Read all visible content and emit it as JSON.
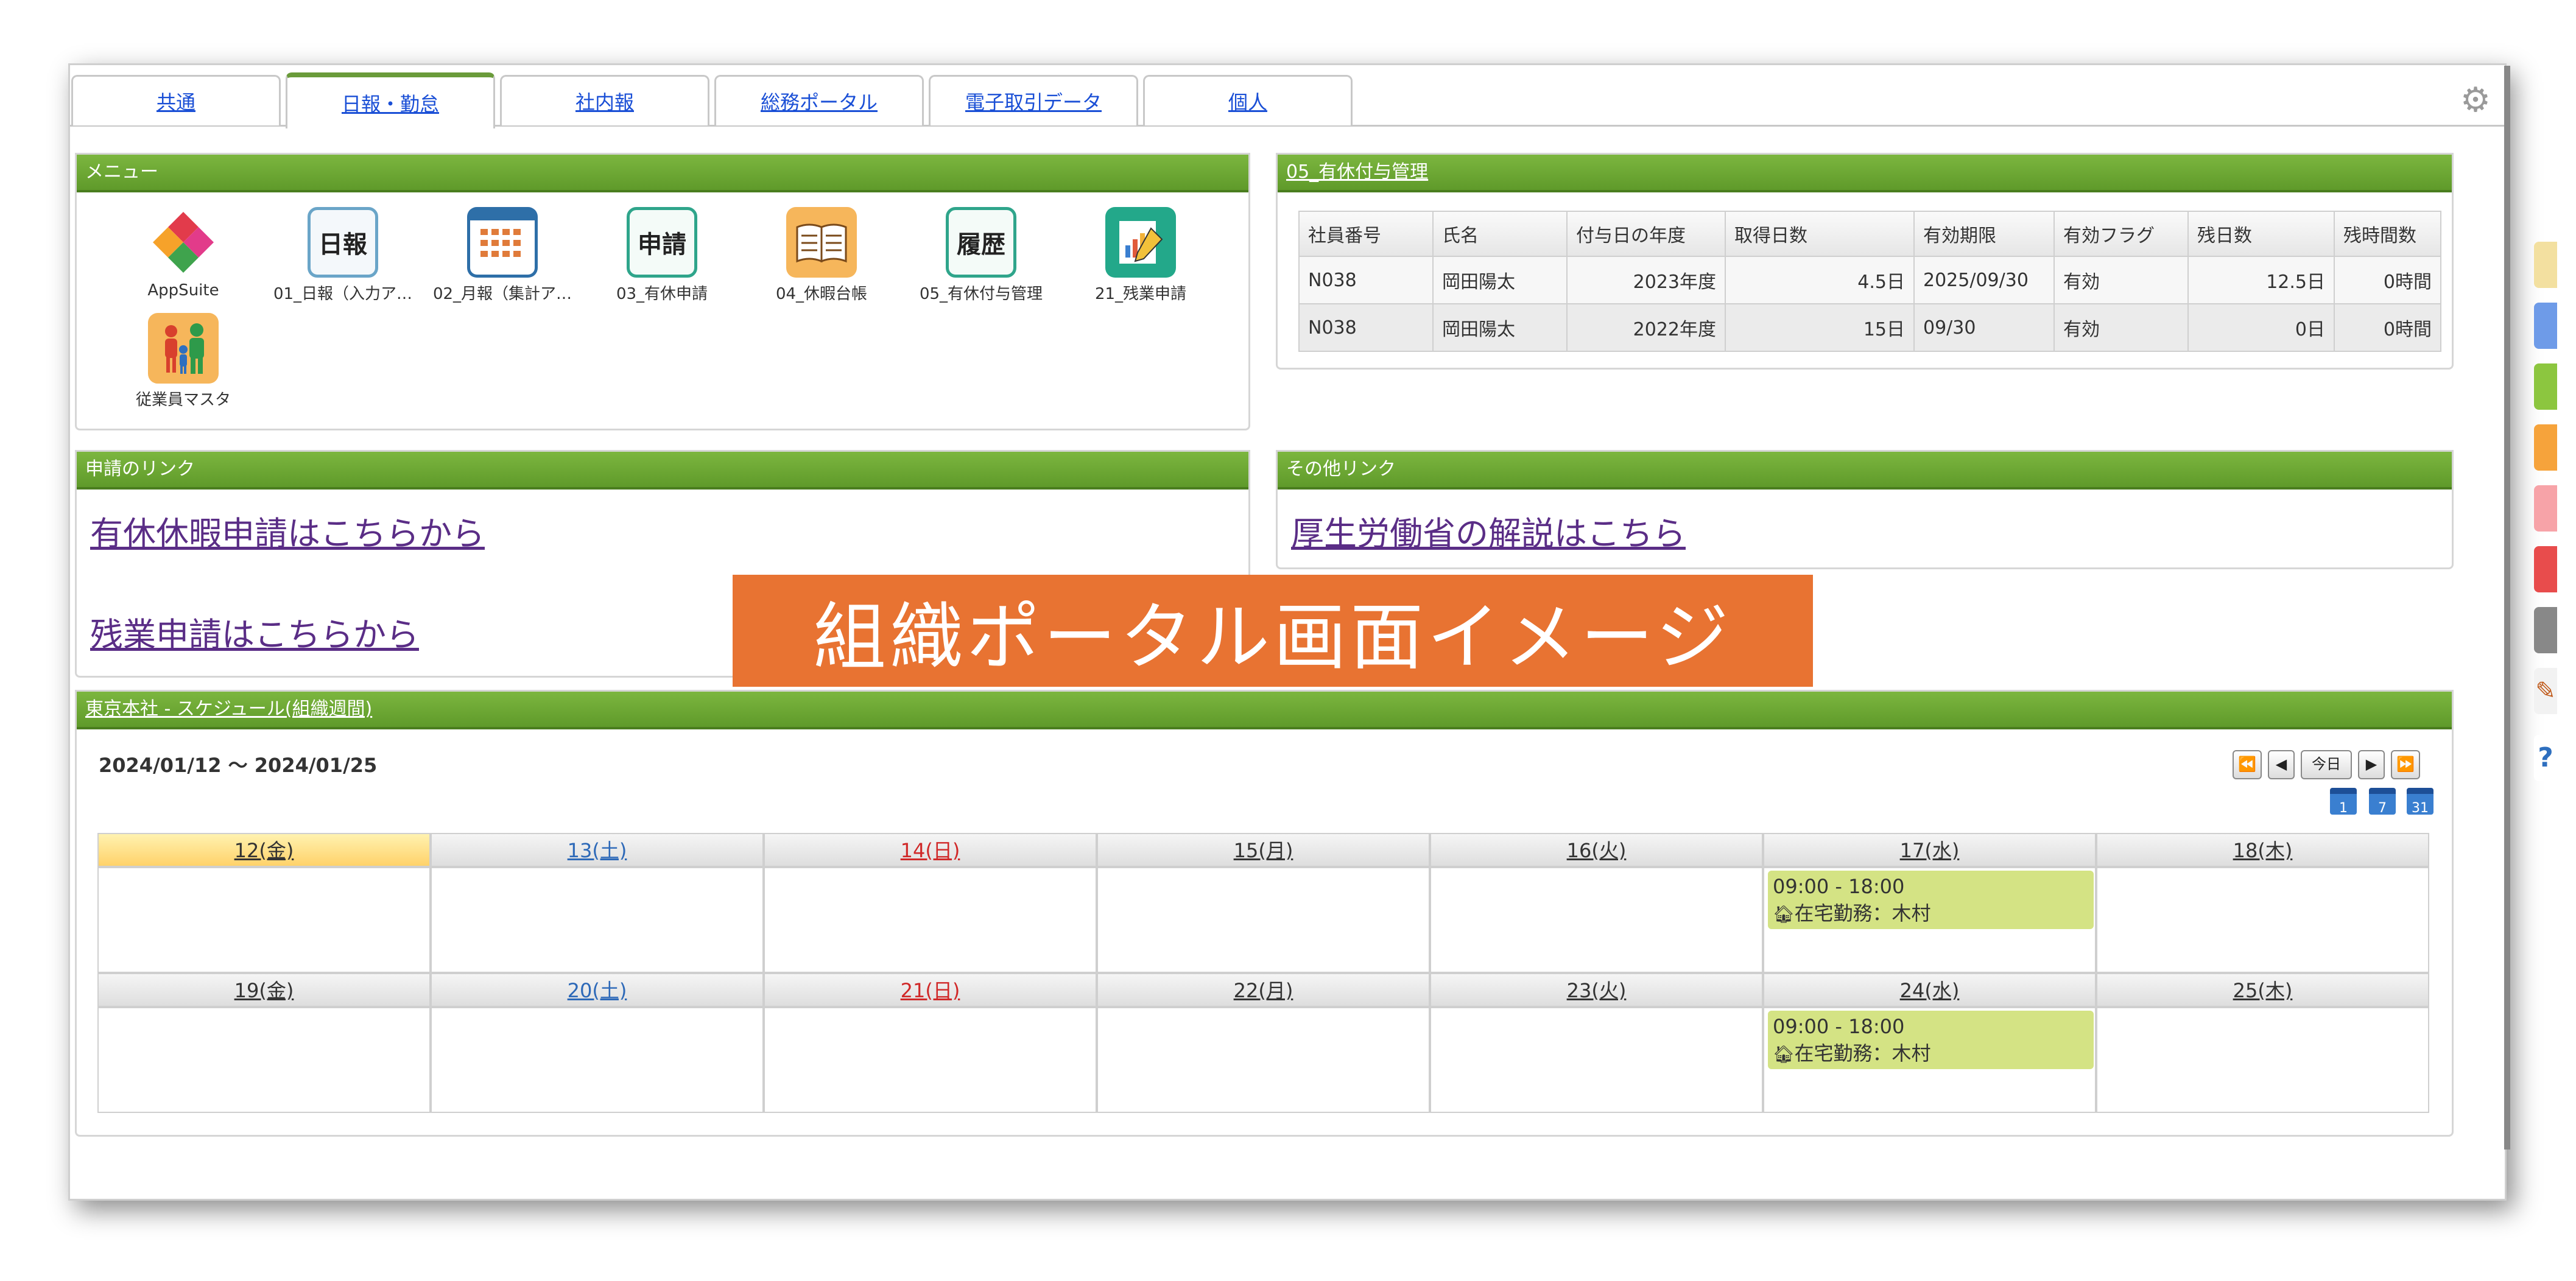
{
  "tabs": [
    {
      "label": "共通",
      "active": false
    },
    {
      "label": "日報・勤怠",
      "active": true
    },
    {
      "label": "社内報",
      "active": false
    },
    {
      "label": "総務ポータル",
      "active": false
    },
    {
      "label": "電子取引データ",
      "active": false
    },
    {
      "label": "個人",
      "active": false
    }
  ],
  "menu": {
    "title": "メニュー",
    "items": [
      {
        "label": "AppSuite",
        "icon": "appsuite-icon",
        "glyph": ""
      },
      {
        "label": "01_日報（入力ア…",
        "icon": "daily-report-icon",
        "glyph": "日報"
      },
      {
        "label": "02_月報（集計ア…",
        "icon": "monthly-report-icon",
        "glyph": ""
      },
      {
        "label": "03_有休申請",
        "icon": "leave-application-icon",
        "glyph": "申請"
      },
      {
        "label": "04_休暇台帳",
        "icon": "leave-ledger-icon",
        "glyph": ""
      },
      {
        "label": "05_有休付与管理",
        "icon": "history-icon",
        "glyph": "履歴"
      },
      {
        "label": "21_残業申請",
        "icon": "overtime-icon",
        "glyph": ""
      },
      {
        "label": "従業員マスタ",
        "icon": "employee-master-icon",
        "glyph": ""
      }
    ]
  },
  "leave_panel": {
    "title": "05_有休付与管理",
    "columns": [
      "社員番号",
      "氏名",
      "付与日の年度",
      "取得日数",
      "有効期限",
      "有効フラグ",
      "残日数",
      "残時間数"
    ],
    "rows": [
      [
        "N038",
        "岡田陽太",
        "2023年度",
        "4.5日",
        "2025/09/30",
        "有効",
        "12.5日",
        "0時間"
      ],
      [
        "N038",
        "岡田陽太",
        "2022年度",
        "15日",
        "09/30",
        "有効",
        "0日",
        "0時間"
      ]
    ]
  },
  "apply_links": {
    "title": "申請のリンク",
    "leave_link": "有休休暇申請はこちらから",
    "overtime_link": "残業申請はこちらから"
  },
  "other_links": {
    "title": "その他リンク",
    "mhlw_link": "厚生労働省の解説はこちら"
  },
  "banner": "組織ポータル画面イメージ",
  "schedule": {
    "title": "東京本社 - スケジュール(組織週間)",
    "range": "2024/01/12 ～ 2024/01/25",
    "today_label": "今日",
    "view_icons": [
      "1",
      "7",
      "31"
    ],
    "weeks": [
      [
        {
          "day": "12(金)",
          "type": "today"
        },
        {
          "day": "13(土)",
          "type": "sat"
        },
        {
          "day": "14(日)",
          "type": "sun"
        },
        {
          "day": "15(月)",
          "type": "normal"
        },
        {
          "day": "16(火)",
          "type": "normal"
        },
        {
          "day": "17(水)",
          "type": "normal",
          "event": {
            "time": "09:00 - 18:00",
            "title": "在宅勤務：木村"
          }
        },
        {
          "day": "18(木)",
          "type": "normal"
        }
      ],
      [
        {
          "day": "19(金)",
          "type": "normal"
        },
        {
          "day": "20(土)",
          "type": "sat"
        },
        {
          "day": "21(日)",
          "type": "sun"
        },
        {
          "day": "22(月)",
          "type": "normal"
        },
        {
          "day": "23(火)",
          "type": "normal"
        },
        {
          "day": "24(水)",
          "type": "normal",
          "event": {
            "time": "09:00 - 18:00",
            "title": "在宅勤務：木村"
          }
        },
        {
          "day": "25(木)",
          "type": "normal"
        }
      ]
    ]
  },
  "colors": {
    "header_green": "#6fa83a",
    "banner_orange": "#e87332",
    "event_green": "#d4e384",
    "today_yellow": "#ffd26a",
    "side_palette": [
      "#f3c84a",
      "#6e9be8",
      "#8cc63f",
      "#f6a33b",
      "#f7a3a8",
      "#e84c4c",
      "#888888"
    ]
  }
}
